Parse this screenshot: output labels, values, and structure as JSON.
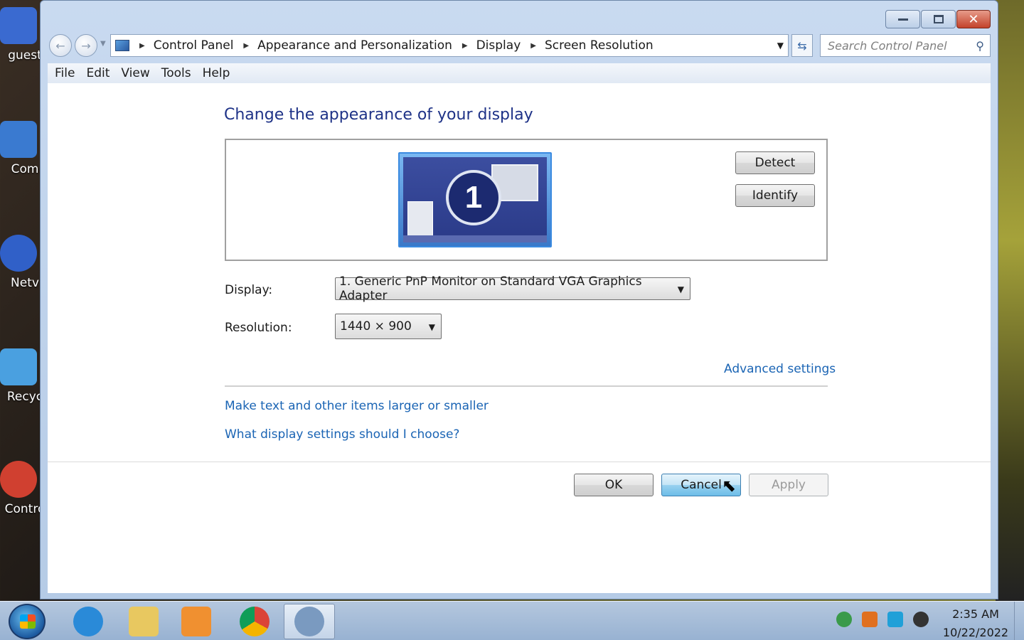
{
  "desktop": {
    "icons": [
      {
        "label": "guest",
        "color": "#3a6ad0"
      },
      {
        "label": "Com",
        "color": "#3a7ad0"
      },
      {
        "label": "Netv",
        "color": "#3060c8"
      },
      {
        "label": "Recyc",
        "color": "#4aa0e0"
      },
      {
        "label": "Contro",
        "color": "#d04030"
      }
    ]
  },
  "window": {
    "nav": {
      "back_icon": "arrow-left-icon",
      "forward_icon": "arrow-right-icon",
      "breadcrumbs": [
        "Control Panel",
        "Appearance and Personalization",
        "Display",
        "Screen Resolution"
      ],
      "search_placeholder": "Search Control Panel"
    },
    "menu": [
      "File",
      "Edit",
      "View",
      "Tools",
      "Help"
    ],
    "page": {
      "title": "Change the appearance of your display",
      "monitor_number": "1",
      "detect_label": "Detect",
      "identify_label": "Identify",
      "display_label": "Display:",
      "display_value": "1. Generic PnP Monitor on Standard VGA Graphics Adapter",
      "resolution_label": "Resolution:",
      "resolution_value": "1440 × 900",
      "advanced_link": "Advanced settings",
      "links": [
        "Make text and other items larger or smaller",
        "What display settings should I choose?"
      ],
      "ok_label": "OK",
      "cancel_label": "Cancel",
      "apply_label": "Apply"
    }
  },
  "taskbar": {
    "apps": [
      {
        "name": "internet-explorer",
        "color": "#2a8ad8"
      },
      {
        "name": "file-explorer",
        "color": "#e8c860"
      },
      {
        "name": "media-player",
        "color": "#f09030"
      },
      {
        "name": "chrome",
        "color": "#db4437"
      },
      {
        "name": "control-panel",
        "color": "#7a9ac0"
      }
    ],
    "tray": [
      "network-icon",
      "search-icon",
      "monitor-icon",
      "webcam-icon"
    ],
    "time": "2:35 AM",
    "date": "10/22/2022"
  }
}
